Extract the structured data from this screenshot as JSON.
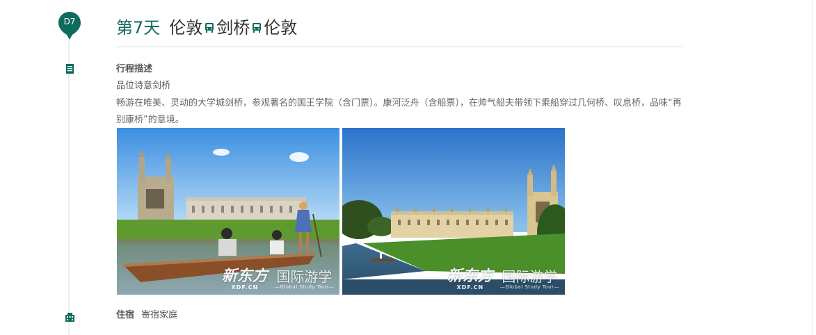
{
  "colors": {
    "accent": "#0e6b5e",
    "text": "#555555",
    "divider": "#dddddd"
  },
  "day": {
    "badge": "D7",
    "label": "第7天",
    "route": [
      {
        "city": "伦敦",
        "transport_icon": "bus-icon"
      },
      {
        "city": "剑桥",
        "transport_icon": "bus-icon"
      },
      {
        "city": "伦敦"
      }
    ]
  },
  "description": {
    "icon": "document-icon",
    "title": "行程描述",
    "subtitle": "品位诗意剑桥",
    "body": "畅游在唯美、灵动的大学城剑桥，参观著名的国王学院（含门票）。康河泛舟（含船票），在帅气船夫带领下乘船穿过几何桥、叹息桥，品味“再别康桥”的意境。"
  },
  "photos": [
    {
      "name": "punting-on-cam-river",
      "watermark_brand": "新东方",
      "watermark_brand_en": "XDF.CN",
      "watermark_program": "国际游学",
      "watermark_program_en": "—Global Study Tour—"
    },
    {
      "name": "kings-college-lawn",
      "watermark_brand": "新东方",
      "watermark_brand_en": "XDF.CN",
      "watermark_program": "国际游学",
      "watermark_program_en": "—Global Study Tour—"
    }
  ],
  "stay": {
    "icon": "building-icon",
    "label": "住宿",
    "value": "寄宿家庭"
  }
}
